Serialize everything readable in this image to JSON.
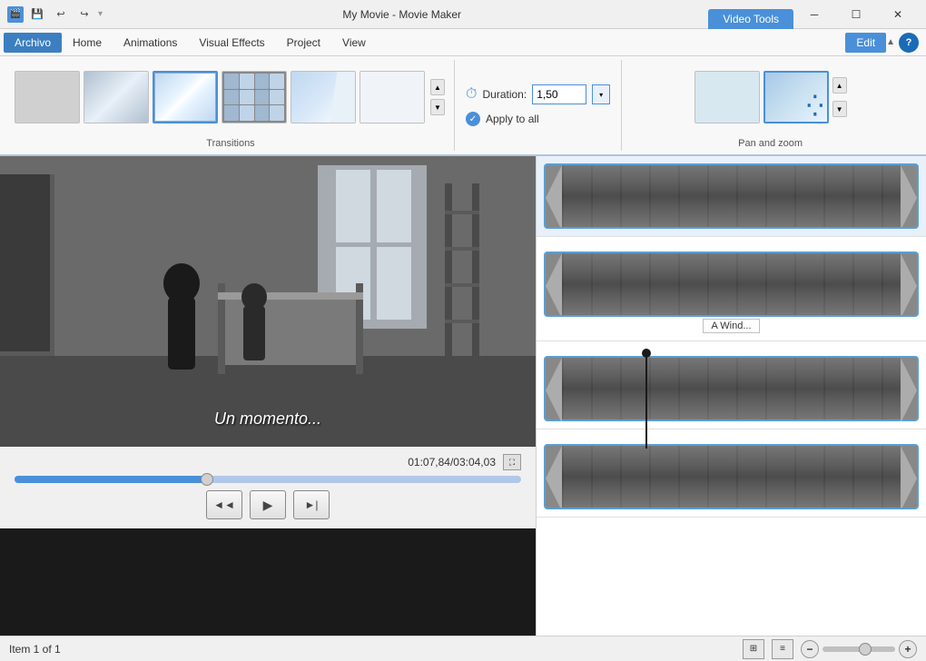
{
  "titleBar": {
    "appTitle": "My Movie - Movie Maker",
    "videoToolsTab": "Video Tools",
    "quickAccess": [
      "💾",
      "↩",
      "↪"
    ],
    "windowControls": {
      "minimize": "─",
      "restore": "☐",
      "close": "✕"
    }
  },
  "menuBar": {
    "items": [
      {
        "label": "Archivo",
        "active": true
      },
      {
        "label": "Home",
        "active": false
      },
      {
        "label": "Animations",
        "active": false
      },
      {
        "label": "Visual Effects",
        "active": false
      },
      {
        "label": "Project",
        "active": false
      },
      {
        "label": "View",
        "active": false
      },
      {
        "label": "Edit",
        "active": false,
        "highlight": true
      }
    ]
  },
  "ribbon": {
    "transitions": {
      "label": "Transitions",
      "duration": {
        "label": "Duration:",
        "value": "1,50"
      },
      "applyToAll": "Apply to all"
    },
    "panZoom": {
      "label": "Pan and zoom"
    }
  },
  "videoPlayer": {
    "subtitle": "Un momento...",
    "currentTime": "01:07,84",
    "totalTime": "03:04,03",
    "controls": {
      "rewind": "◄◄",
      "play": "▶",
      "forward": "►|"
    }
  },
  "timeline": {
    "clips": [
      {
        "id": 1,
        "label": ""
      },
      {
        "id": 2,
        "label": "A Wind..."
      },
      {
        "id": 3,
        "label": ""
      },
      {
        "id": 4,
        "label": ""
      }
    ]
  },
  "statusBar": {
    "itemCount": "Item 1 of 1"
  }
}
